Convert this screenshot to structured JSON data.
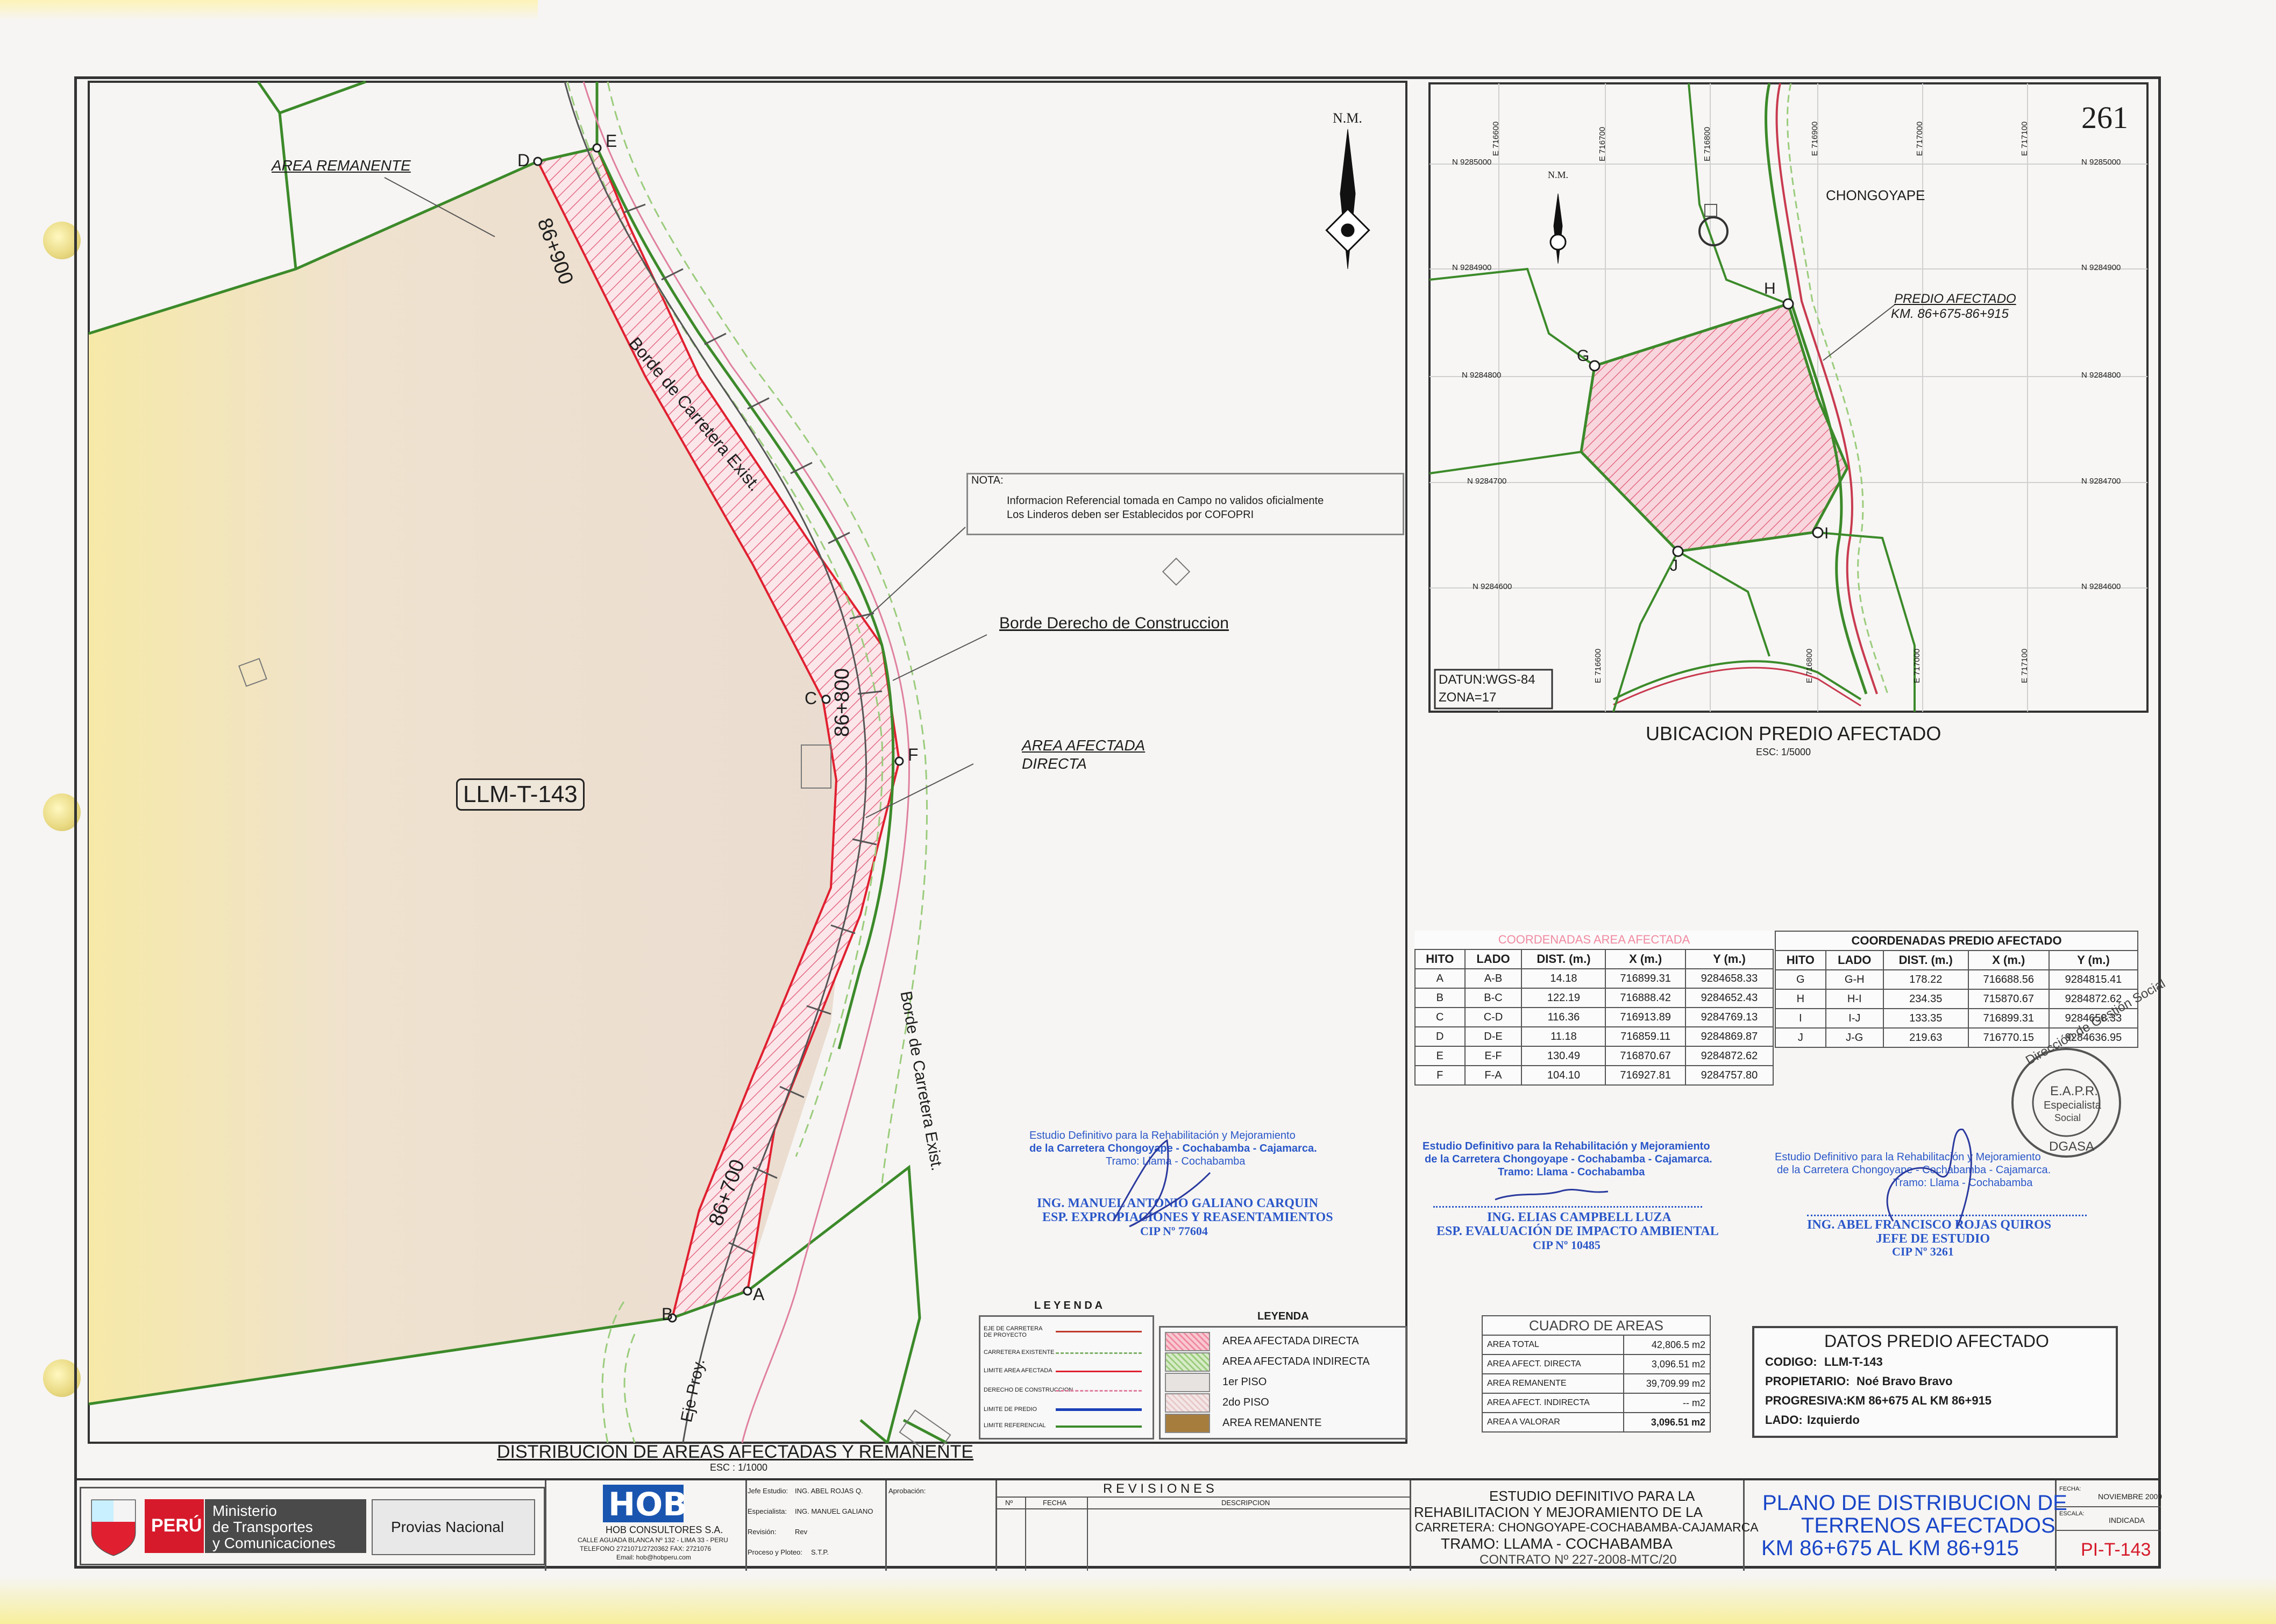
{
  "sheet_number": "261",
  "main_plan": {
    "north_label": "N.M.",
    "labels": {
      "area_remanente": "AREA REMANENTE",
      "lot_code": "LLM-T-143",
      "borde_carretera_1": "Borde de Carretera Exist.",
      "borde_carretera_2": "Borde de Carretera Exist.",
      "borde_derecho": "Borde Derecho de Construccion",
      "area_afectada": "AREA AFECTADA",
      "directa": "DIRECTA",
      "eje_proy": "Eje Proy.",
      "km_900": "86+900",
      "km_800": "86+800",
      "km_700": "86+700"
    },
    "points": [
      "A",
      "B",
      "C",
      "D",
      "E",
      "F"
    ],
    "nota": {
      "title": "NOTA:",
      "line1": "Informacion Referencial tomada en Campo no validos oficialmente",
      "line2": "Los Linderos deben ser Establecidos por COFOPRI"
    },
    "title": "DISTRIBUCION DE AREAS AFECTADAS Y REMANENTE",
    "scale": "ESC : 1/1000"
  },
  "location_map": {
    "north_label": "N.M.",
    "town": "CHONGOYAPE",
    "predio_label": "PREDIO AFECTADO",
    "predio_km": "KM. 86+675-86+915",
    "points": [
      "G",
      "H",
      "I",
      "J"
    ],
    "north_ticks": [
      "N 9285000",
      "N 9284900",
      "N 9284800",
      "N 9284700",
      "N 9284600"
    ],
    "east_ticks": [
      "E 716600",
      "E 716700",
      "E 716800",
      "E 716900",
      "E 717000",
      "E 717100"
    ],
    "datum_line1": "DATUN:WGS-84",
    "datum_line2": "ZONA=17",
    "title": "UBICACION PREDIO AFECTADO",
    "scale": "ESC: 1/5000"
  },
  "coord_area_afectada": {
    "title": "COORDENADAS AREA AFECTADA",
    "headers": [
      "HITO",
      "LADO",
      "DIST. (m.)",
      "X (m.)",
      "Y (m.)"
    ],
    "rows": [
      [
        "A",
        "A-B",
        "14.18",
        "716899.31",
        "9284658.33"
      ],
      [
        "B",
        "B-C",
        "122.19",
        "716888.42",
        "9284652.43"
      ],
      [
        "C",
        "C-D",
        "116.36",
        "716913.89",
        "9284769.13"
      ],
      [
        "D",
        "D-E",
        "11.18",
        "716859.11",
        "9284869.87"
      ],
      [
        "E",
        "E-F",
        "130.49",
        "716870.67",
        "9284872.62"
      ],
      [
        "F",
        "F-A",
        "104.10",
        "716927.81",
        "9284757.80"
      ]
    ]
  },
  "coord_predio": {
    "title": "COORDENADAS PREDIO AFECTADO",
    "headers": [
      "HITO",
      "LADO",
      "DIST. (m.)",
      "X (m.)",
      "Y (m.)"
    ],
    "rows": [
      [
        "G",
        "G-H",
        "178.22",
        "716688.56",
        "9284815.41"
      ],
      [
        "H",
        "H-I",
        "234.35",
        "715870.67",
        "9284872.62"
      ],
      [
        "I",
        "I-J",
        "133.35",
        "716899.31",
        "9284658.33"
      ],
      [
        "J",
        "J-G",
        "219.63",
        "716770.15",
        "9284636.95"
      ]
    ]
  },
  "signatures": [
    {
      "line1": "Estudio Definitivo para la Rehabilitación y Mejoramiento",
      "line2": "de la Carretera Chongoyape - Cochabamba - Cajamarca.",
      "line3": "Tramo: Llama - Cochabamba",
      "name": "ING. MANUEL ANTONIO GALIANO CARQUIN",
      "role": "ESP. EXPROPIACIONES Y REASENTAMIENTOS",
      "cip": "CIP Nº 77604"
    },
    {
      "line1": "Estudio Definitivo para la Rehabilitación y Mejoramiento",
      "line2": "de la Carretera Chongoyape - Cochabamba - Cajamarca.",
      "line3": "Tramo: Llama - Cochabamba",
      "name": "ING. ELIAS CAMPBELL LUZA",
      "role": "ESP. EVALUACIÓN DE IMPACTO AMBIENTAL",
      "cip": "CIP Nº 10485"
    },
    {
      "line1": "Estudio Definitivo para la Rehabilitación y Mejoramiento",
      "line2": "de la Carretera Chongoyape - Cochabamba - Cajamarca.",
      "line3": "Tramo: Llama - Cochabamba",
      "name": "ING. ABEL FRANCISCO ROJAS QUIROS",
      "role": "JEFE DE ESTUDIO",
      "cip": "CIP Nº 3261"
    }
  ],
  "seal": {
    "ring": "Dirección de Gestión Social",
    "center1": "E.A.P.R.",
    "center2": "Especialista",
    "center3": "Social",
    "bottom": "DGASA"
  },
  "leyenda_lines": {
    "title": "L E Y E N D A",
    "items": [
      "EJE DE CARRETERA DE PROYECTO",
      "CARRETERA EXISTENTE",
      "LIMITE AREA AFECTADA",
      "DERECHO DE CONSTRUCCION",
      "LIMITE DE PREDIO",
      "LIMITE REFERENCIAL"
    ],
    "colors": [
      "#c0392b",
      "#7fb069",
      "#e02030",
      "#e080a0",
      "#1a3fb8",
      "#3c8a2a"
    ]
  },
  "leyenda_areas": {
    "title": "LEYENDA",
    "items": [
      "AREA AFECTADA DIRECTA",
      "AREA AFECTADA INDIRECTA",
      "1er PISO",
      "2do PISO",
      "AREA REMANENTE"
    ]
  },
  "cuadro_areas": {
    "title": "CUADRO DE AREAS",
    "rows": [
      [
        "AREA TOTAL",
        "42,806.5 m2"
      ],
      [
        "AREA AFECT. DIRECTA",
        "3,096.51 m2"
      ],
      [
        "AREA REMANENTE",
        "39,709.99 m2"
      ],
      [
        "AREA AFECT. INDIRECTA",
        "-- m2"
      ],
      [
        "AREA A VALORAR",
        "3,096.51 m2"
      ]
    ]
  },
  "datos_predio": {
    "title": "DATOS PREDIO AFECTADO",
    "codigo_label": "CODIGO:",
    "codigo": "LLM-T-143",
    "propietario_label": "PROPIETARIO:",
    "propietario": "Noé Bravo Bravo",
    "progresiva_label": "PROGRESIVA:",
    "progresiva": "KM 86+675 AL KM 86+915",
    "lado_label": "LADO:",
    "lado": "Izquierdo"
  },
  "title_block": {
    "peru": "PERÚ",
    "ministry1": "Ministerio",
    "ministry2": "de Transportes",
    "ministry3": "y Comunicaciones",
    "provias": "Provias Nacional",
    "hob_logo": "HOB",
    "hob_name": "HOB CONSULTORES S.A.",
    "hob_addr": "CALLE AGUADA BLANCA Nº 132 - LIMA 33 - PERU",
    "hob_tel": "TELEFONO 2721071/2720362  FAX: 2721076",
    "hob_mail": "Email: hob@hobperu.com",
    "jefe_label": "Jefe Estudio:",
    "jefe": "ING. ABEL ROJAS Q.",
    "esp_label": "Especialista:",
    "esp": "ING. MANUEL GALIANO",
    "revision_label": "Revisión:",
    "revision": "Rev",
    "proceso_label": "Proceso y Ploteo:",
    "proceso": "S.T.P.",
    "aprobado_label": "Aprobación:",
    "revisiones": "R E V I S I O N E S",
    "rev_no": "Nº",
    "rev_fecha": "FECHA",
    "rev_desc": "DESCRIPCION",
    "estudio1": "ESTUDIO DEFINITIVO PARA LA",
    "estudio2": "REHABILITACION Y MEJORAMIENTO DE LA",
    "estudio3": "CARRETERA: CHONGOYAPE-COCHABAMBA-CAJAMARCA",
    "estudio4": "TRAMO: LLAMA - COCHABAMBA",
    "contrato": "CONTRATO Nº 227-2008-MTC/20",
    "plano1": "PLANO DE DISTRIBUCION DE",
    "plano2": "TERRENOS AFECTADOS",
    "plano3": "KM 86+675 AL KM 86+915",
    "fecha_label": "FECHA:",
    "fecha": "NOVIEMBRE 2009",
    "escala_label": "ESCALA:",
    "escala": "INDICADA",
    "plano_code": "PI-T-143"
  },
  "colors": {
    "green": "#3c8a2a",
    "red": "#e02030",
    "pink": "#f0b5c0",
    "blue_plan": "#1a55d6",
    "tan": "#ecdfcf",
    "stamp": "#2b57c9"
  }
}
